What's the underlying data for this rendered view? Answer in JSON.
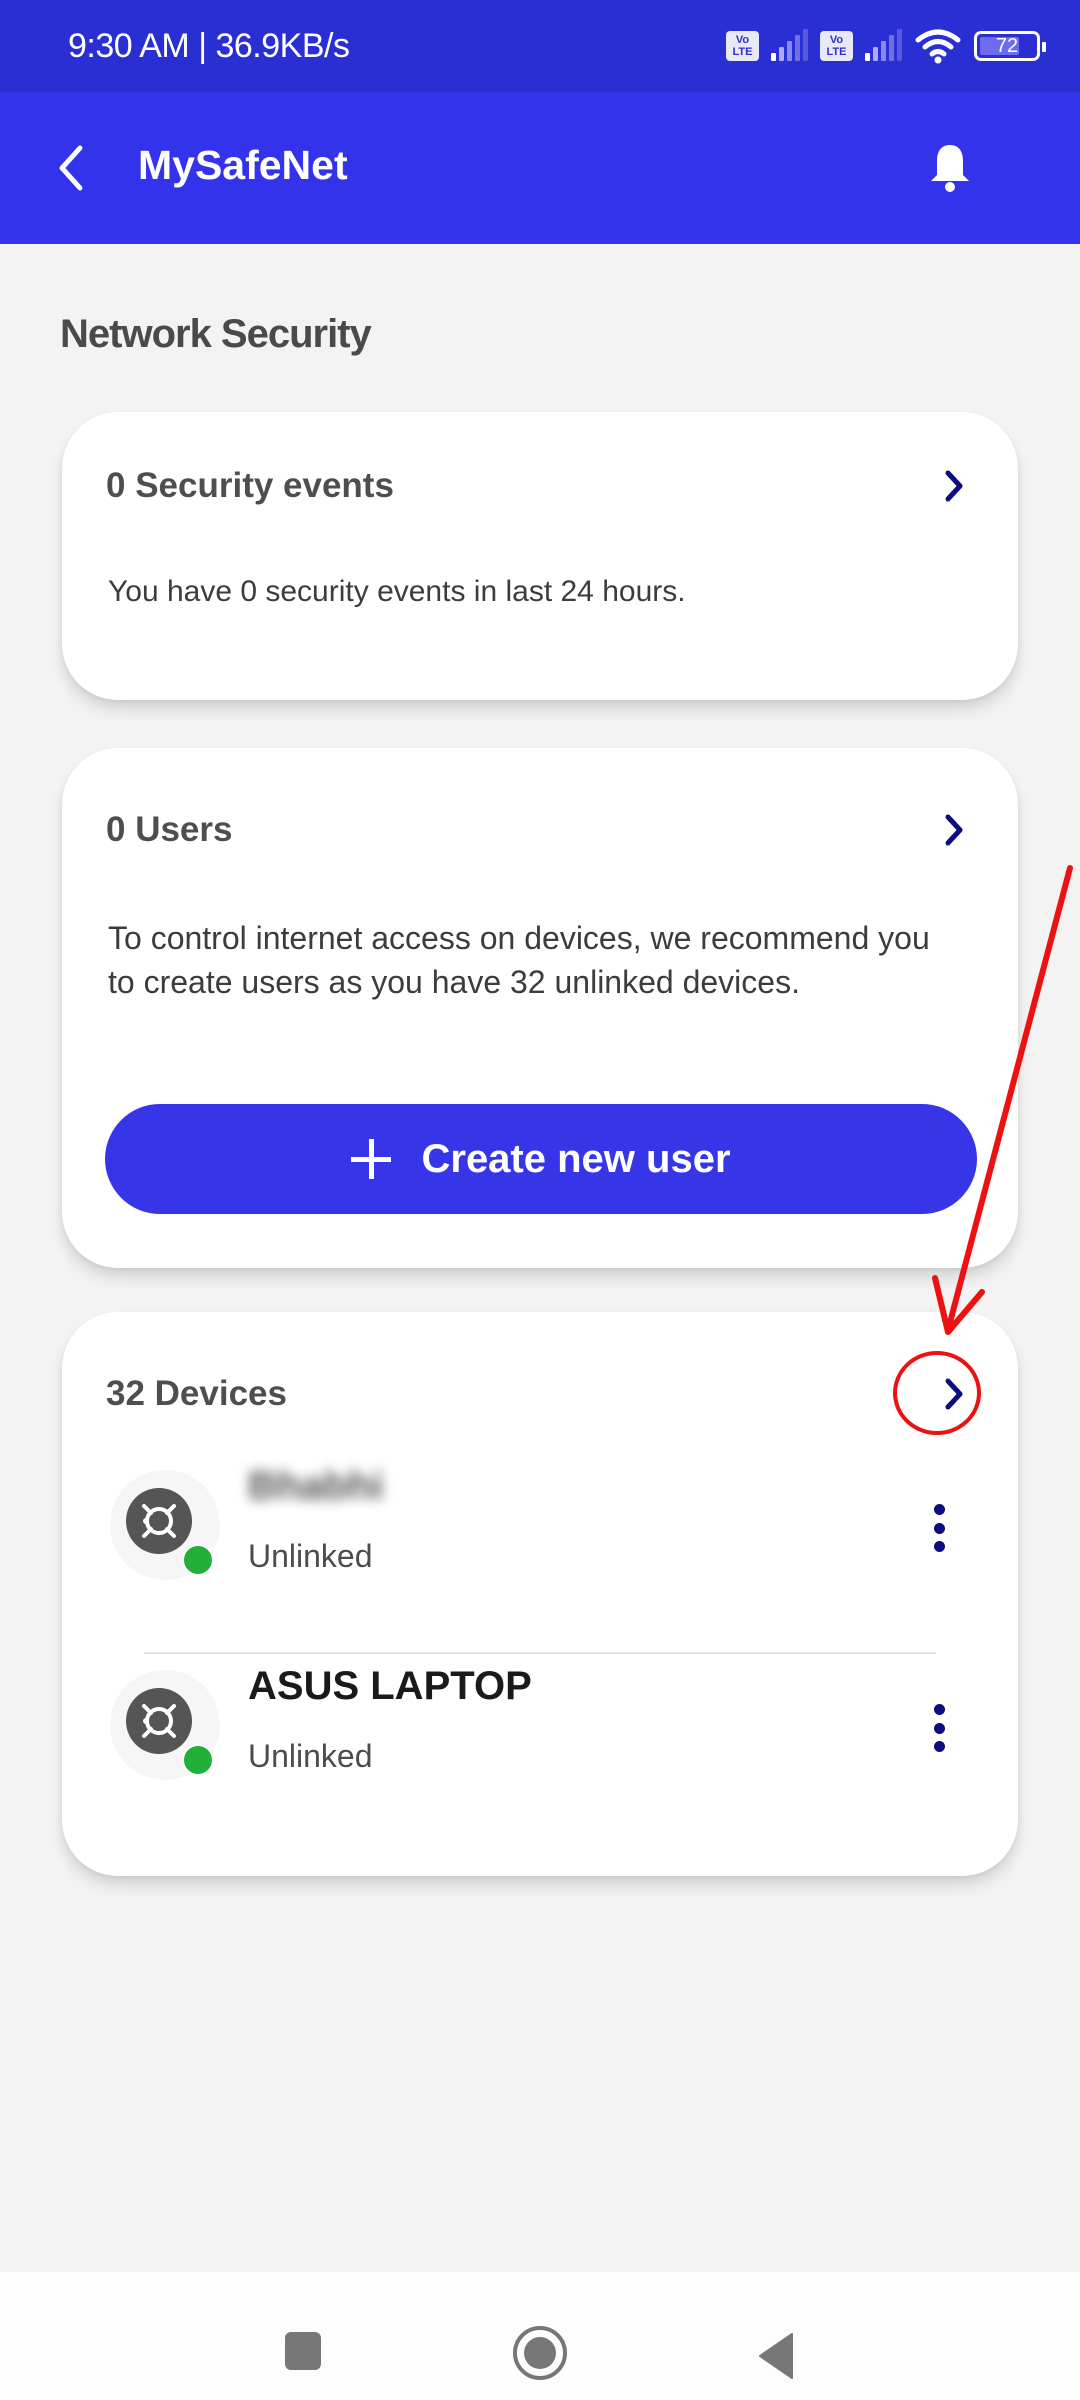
{
  "status_bar": {
    "time_speed": "9:30 AM | 36.9KB/s",
    "volte_label_top": "Vo",
    "volte_label_bottom": "LTE",
    "battery_level": "72",
    "battery_fraction": 0.72,
    "icons": [
      "volte-icon",
      "signal-icon",
      "volte-icon",
      "signal-icon",
      "wifi-icon",
      "battery-icon"
    ]
  },
  "app_bar": {
    "title": "MySafeNet",
    "back_icon": "chevron-left-icon",
    "notification_icon": "bell-icon",
    "color": "#3333ec"
  },
  "page": {
    "section_title": "Network Security"
  },
  "security_card": {
    "title": "0 Security events",
    "description": "You have 0 security events in last 24 hours."
  },
  "users_card": {
    "title": "0 Users",
    "description": "To control internet access on devices, we recommend you to create users as you have 32 unlinked devices.",
    "create_button_label": "Create new user"
  },
  "devices_card": {
    "title": "32 Devices",
    "devices": [
      {
        "name": "Bhabhi",
        "name_redacted": true,
        "status": "Unlinked",
        "online": true
      },
      {
        "name": "ASUS LAPTOP",
        "name_redacted": false,
        "status": "Unlinked",
        "online": true
      }
    ]
  },
  "nav_bar": {
    "buttons": [
      "recents-button",
      "home-button",
      "back-button"
    ]
  },
  "colors": {
    "primary": "#3636e8",
    "status_bar": "#2a2fd4",
    "chevron": "#0d0d7e",
    "online": "#22b03a",
    "annotation": "#ee1111"
  }
}
